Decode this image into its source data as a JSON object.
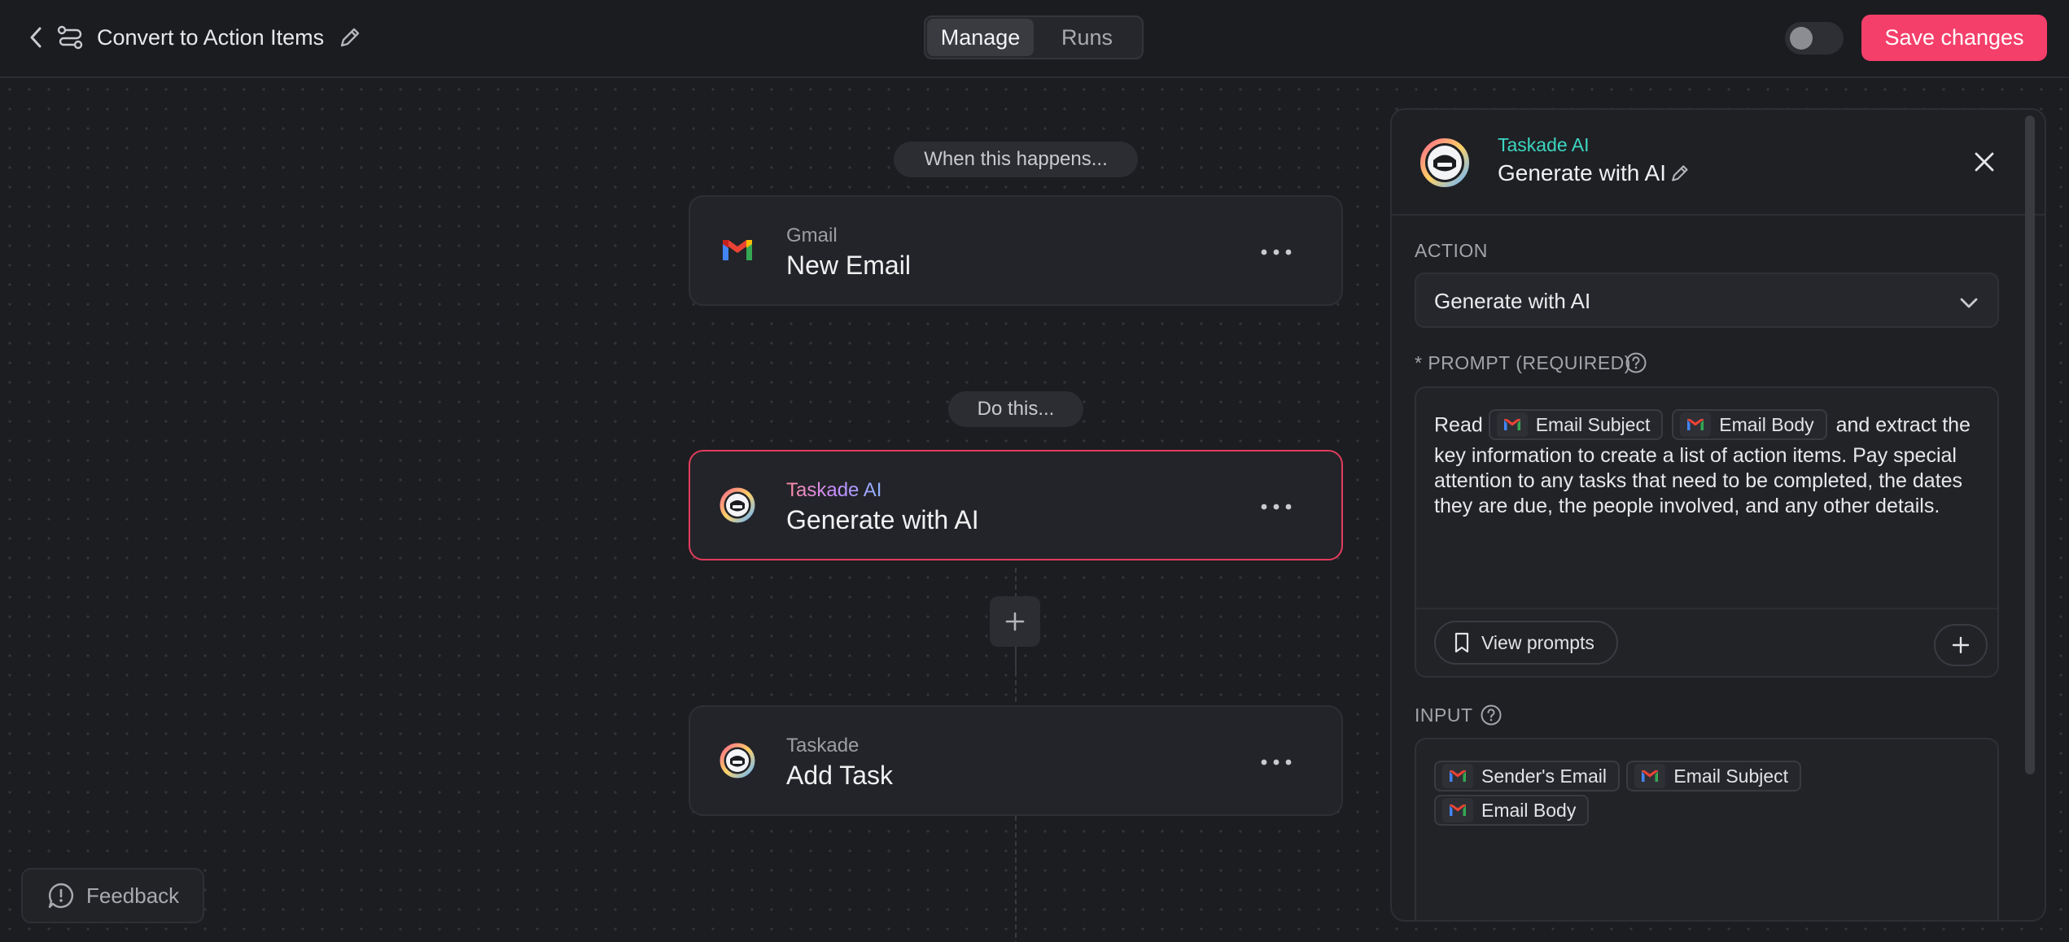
{
  "header": {
    "title": "Convert to Action Items",
    "tabs": [
      {
        "label": "Manage",
        "active": true
      },
      {
        "label": "Runs",
        "active": false
      }
    ],
    "toggle_on": false,
    "save_label": "Save changes"
  },
  "canvas": {
    "trigger_pill": "When this happens...",
    "action_pill": "Do this...",
    "nodes": [
      {
        "app": "Gmail",
        "action": "New Email",
        "icon": "gmail-icon"
      },
      {
        "app": "Taskade AI",
        "action": "Generate with AI",
        "icon": "taskade-ai-icon",
        "selected": true
      },
      {
        "app": "Taskade",
        "action": "Add Task",
        "icon": "taskade-icon"
      }
    ],
    "feedback_label": "Feedback"
  },
  "panel": {
    "app": "Taskade AI",
    "title": "Generate with AI",
    "action_label": "ACTION",
    "action_value": "Generate with AI",
    "prompt_label": "* PROMPT (REQUIRED)",
    "prompt_lead": "Read",
    "prompt_chips": [
      "Email Subject",
      "Email Body"
    ],
    "prompt_rest": "and extract the key information to create a list of action items. Pay special attention to any tasks that need to be completed, the dates they are due, the people involved, and any other details.",
    "view_prompts_label": "View prompts",
    "input_label": "INPUT",
    "input_chips": [
      "Sender's Email",
      "Email Subject",
      "Email Body"
    ]
  },
  "colors": {
    "accent": "#f43f6a",
    "background": "#1b1c20",
    "selected_border": "#e23c5c",
    "ai_label": "#3dd6c2"
  }
}
